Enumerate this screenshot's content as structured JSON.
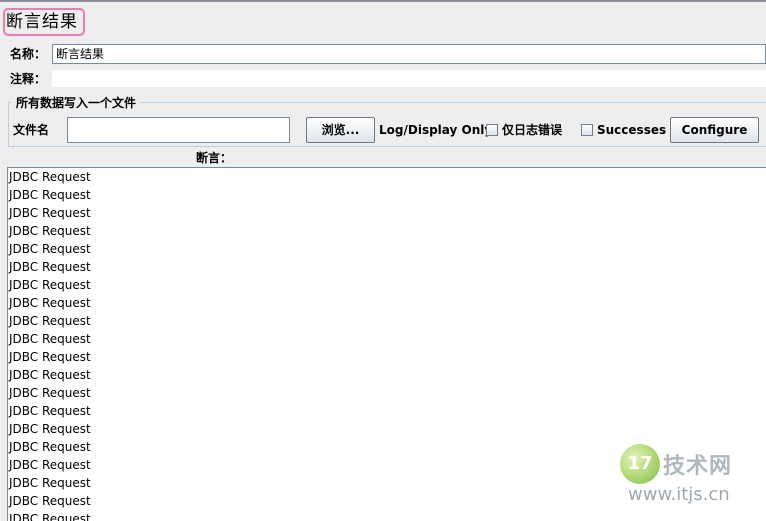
{
  "panel": {
    "title": "断言结果"
  },
  "fields": {
    "name_label": "名称：",
    "name_value": "断言结果",
    "comment_label": "注释：",
    "comment_value": ""
  },
  "file_group": {
    "legend": "所有数据写入一个文件",
    "filename_label": "文件名",
    "filename_value": "",
    "browse_label": "浏览...",
    "log_display_label": "Log/Display Only:",
    "errors_only_label": "仅日志错误",
    "errors_only_checked": false,
    "successes_label": "Successes",
    "successes_checked": false,
    "configure_label": "Configure"
  },
  "assertions": {
    "header": "断言：",
    "items": [
      "JDBC Request",
      "JDBC Request",
      "JDBC Request",
      "JDBC Request",
      "JDBC Request",
      "JDBC Request",
      "JDBC Request",
      "JDBC Request",
      "JDBC Request",
      "JDBC Request",
      "JDBC Request",
      "JDBC Request",
      "JDBC Request",
      "JDBC Request",
      "JDBC Request",
      "JDBC Request",
      "JDBC Request",
      "JDBC Request",
      "JDBC Request",
      "JDBC Request"
    ]
  },
  "watermark": {
    "logo_text": "17",
    "title": "技术网",
    "url": "www.itjs.cn"
  }
}
